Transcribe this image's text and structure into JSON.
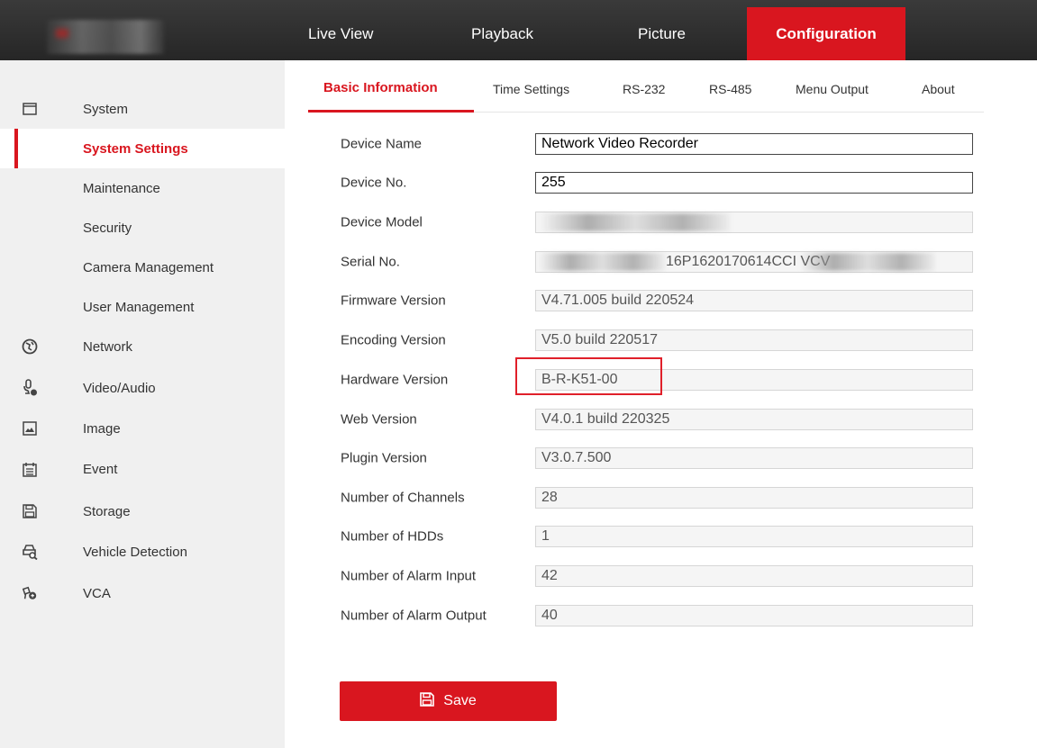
{
  "topnav": {
    "items": [
      {
        "label": "Live View"
      },
      {
        "label": "Playback"
      },
      {
        "label": "Picture"
      },
      {
        "label": "Configuration",
        "active": true
      }
    ]
  },
  "sidebar": {
    "items": [
      {
        "label": "System",
        "icon": "monitor-icon"
      },
      {
        "label": "System Settings",
        "active": true
      },
      {
        "label": "Maintenance"
      },
      {
        "label": "Security"
      },
      {
        "label": "Camera Management"
      },
      {
        "label": "User Management"
      },
      {
        "label": "Network",
        "icon": "globe-icon"
      },
      {
        "label": "Video/Audio",
        "icon": "microphone-icon"
      },
      {
        "label": "Image",
        "icon": "image-icon"
      },
      {
        "label": "Event",
        "icon": "calendar-icon"
      },
      {
        "label": "Storage",
        "icon": "floppy-icon"
      },
      {
        "label": "Vehicle Detection",
        "icon": "vehicle-search-icon"
      },
      {
        "label": "VCA",
        "icon": "vca-icon"
      }
    ]
  },
  "tabs": [
    {
      "label": "Basic Information",
      "active": true
    },
    {
      "label": "Time Settings"
    },
    {
      "label": "RS-232"
    },
    {
      "label": "RS-485"
    },
    {
      "label": "Menu Output"
    },
    {
      "label": "About"
    }
  ],
  "form": {
    "rows": [
      {
        "label": "Device Name",
        "value": "Network Video Recorder",
        "editable": true
      },
      {
        "label": "Device No.",
        "value": "255",
        "editable": true
      },
      {
        "label": "Device Model",
        "value": ""
      },
      {
        "label": "Serial No.",
        "value": "16P1620170614CCI VCV"
      },
      {
        "label": "Firmware Version",
        "value": "V4.71.005 build 220524"
      },
      {
        "label": "Encoding Version",
        "value": "V5.0 build 220517"
      },
      {
        "label": "Hardware Version",
        "value": "B-R-K51-00"
      },
      {
        "label": "Web Version",
        "value": "V4.0.1 build 220325"
      },
      {
        "label": "Plugin Version",
        "value": "V3.0.7.500"
      },
      {
        "label": "Number of Channels",
        "value": "28"
      },
      {
        "label": "Number of HDDs",
        "value": "1"
      },
      {
        "label": "Number of Alarm Input",
        "value": "42"
      },
      {
        "label": "Number of Alarm Output",
        "value": "40"
      }
    ]
  },
  "save_button": {
    "label": "Save",
    "icon": "floppy-icon"
  },
  "colors": {
    "accent": "#d9161f",
    "topbar": "#2e2e2e",
    "sidebar": "#f0f0f0"
  }
}
